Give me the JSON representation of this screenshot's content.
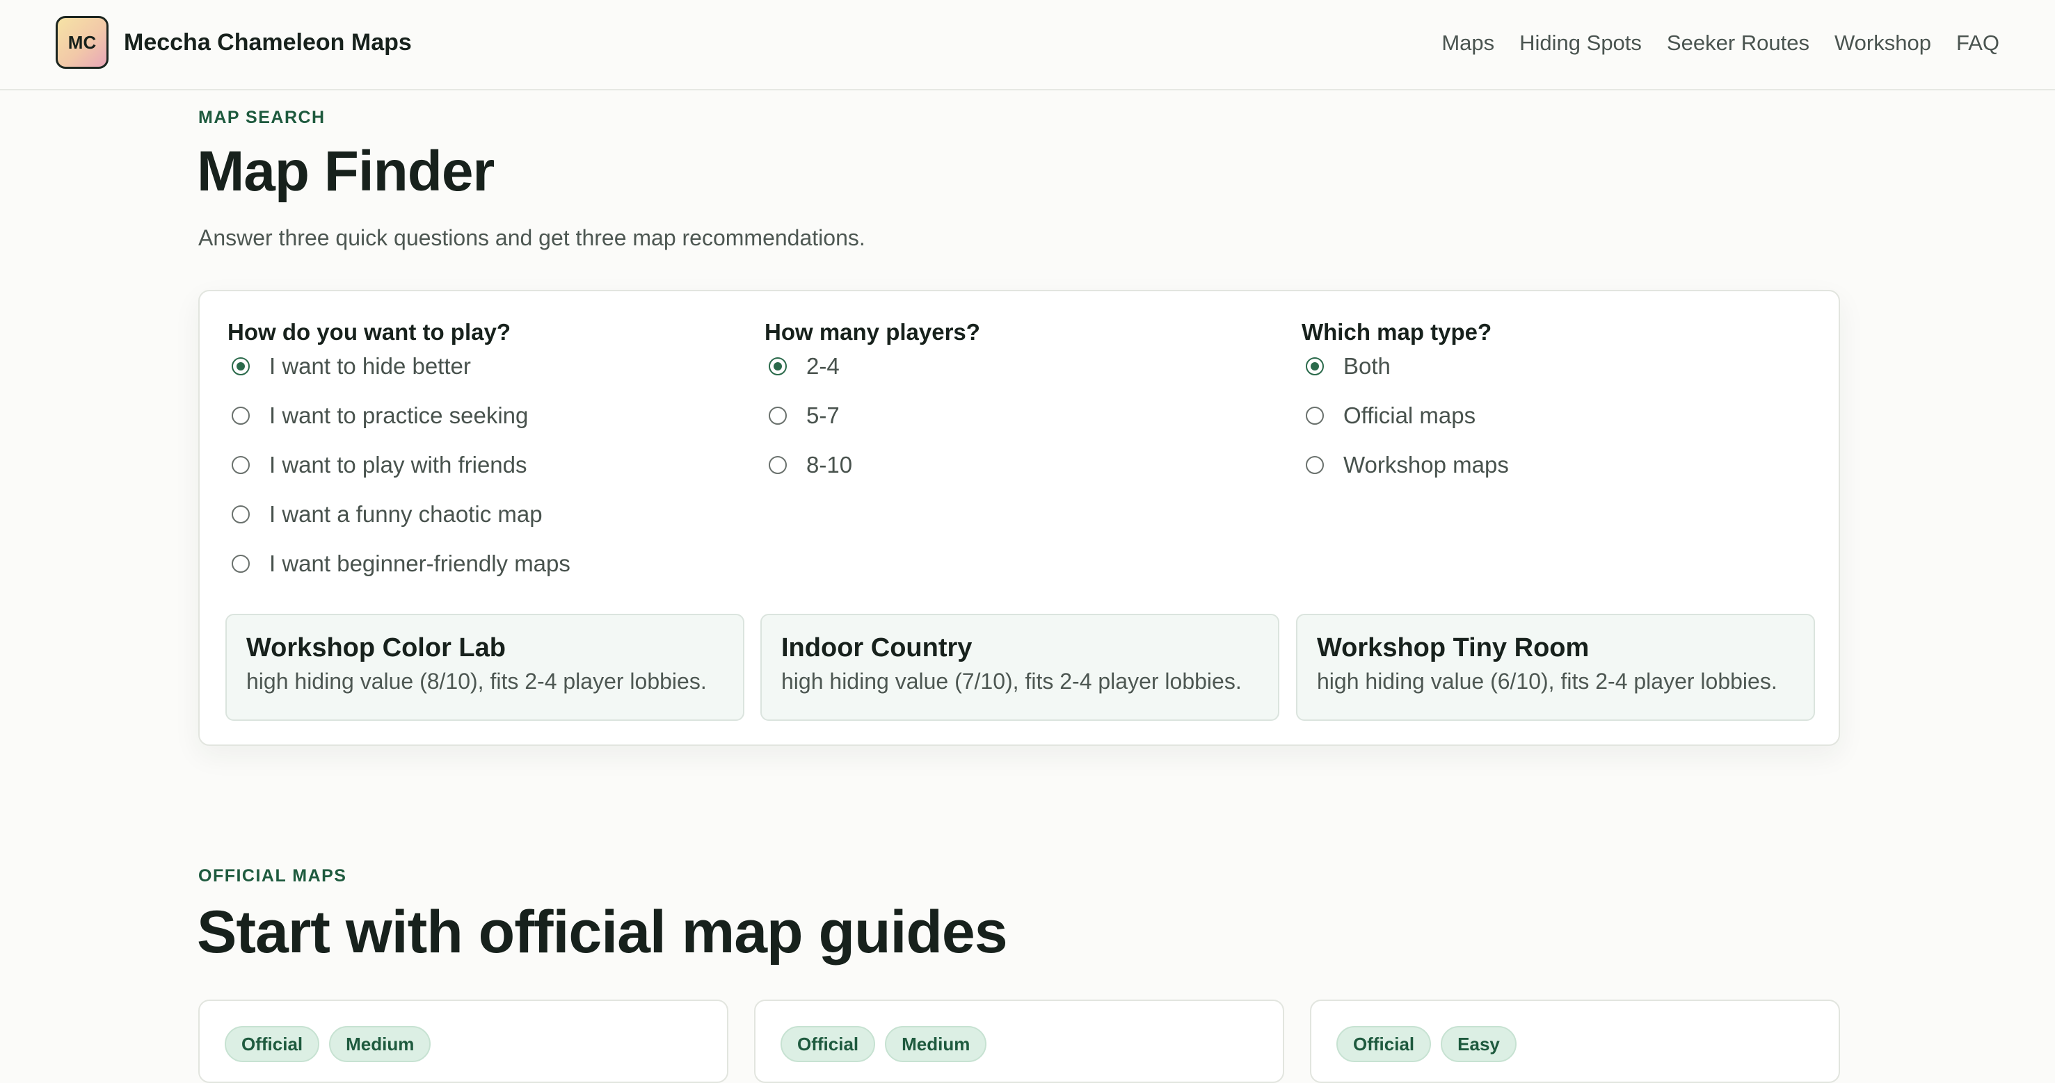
{
  "header": {
    "logo_text": "MC",
    "site_name": "Meccha Chameleon Maps",
    "nav": [
      "Maps",
      "Hiding Spots",
      "Seeker Routes",
      "Workshop",
      "FAQ"
    ]
  },
  "finder": {
    "eyebrow": "MAP SEARCH",
    "title": "Map Finder",
    "lede": "Answer three quick questions and get three map recommendations.",
    "questions": [
      {
        "title": "How do you want to play?",
        "options": [
          "I want to hide better",
          "I want to practice seeking",
          "I want to play with friends",
          "I want a funny chaotic map",
          "I want beginner-friendly maps"
        ],
        "selected": 0
      },
      {
        "title": "How many players?",
        "options": [
          "2-4",
          "5-7",
          "8-10"
        ],
        "selected": 0
      },
      {
        "title": "Which map type?",
        "options": [
          "Both",
          "Official maps",
          "Workshop maps"
        ],
        "selected": 0
      }
    ],
    "recommendations": [
      {
        "title": "Workshop Color Lab",
        "desc": "high hiding value (8/10), fits 2-4 player lobbies."
      },
      {
        "title": "Indoor Country",
        "desc": "high hiding value (7/10), fits 2-4 player lobbies."
      },
      {
        "title": "Workshop Tiny Room",
        "desc": "high hiding value (6/10), fits 2-4 player lobbies."
      }
    ]
  },
  "official": {
    "eyebrow": "OFFICIAL MAPS",
    "title": "Start with official map guides",
    "cards": [
      {
        "tags": [
          "Official",
          "Medium"
        ]
      },
      {
        "tags": [
          "Official",
          "Medium"
        ]
      },
      {
        "tags": [
          "Official",
          "Easy"
        ]
      }
    ]
  },
  "colors": {
    "accent": "#1e5a3e",
    "radio_checked": "#2b6a4b",
    "background": "#fbfbf9",
    "tag_bg": "#dcefe4",
    "rec_bg": "#f3f8f5"
  }
}
